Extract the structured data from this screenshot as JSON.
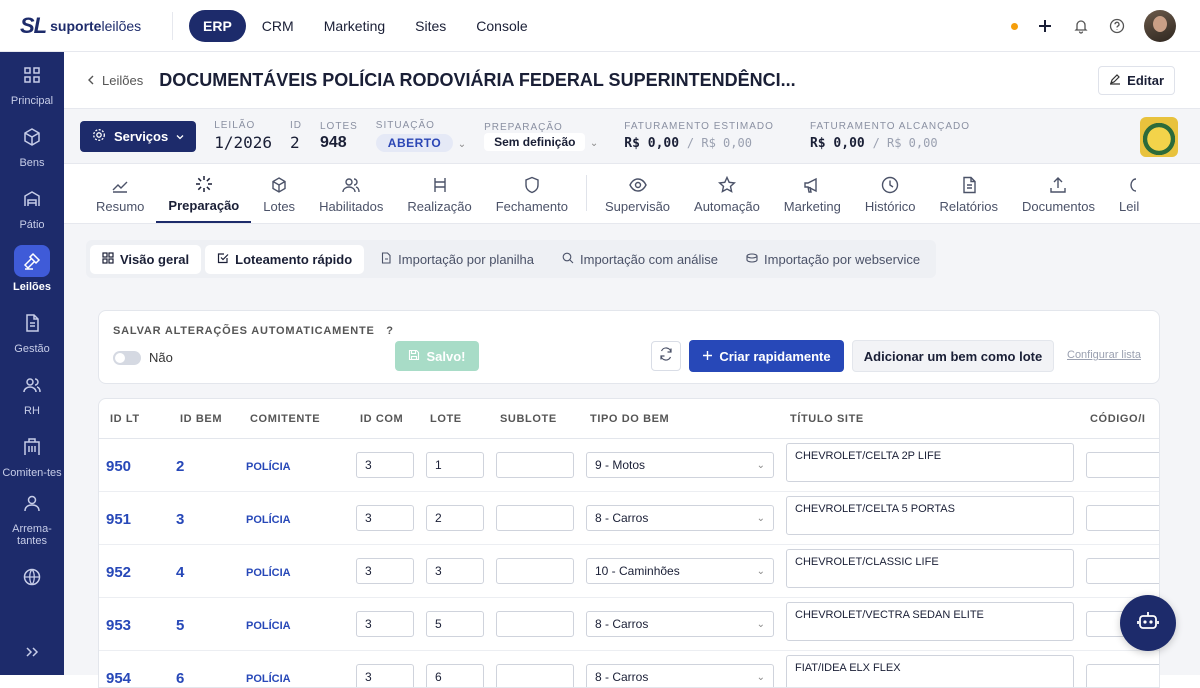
{
  "brand": {
    "mark": "SL",
    "name_bold": "suporte",
    "name_rest": "leilões"
  },
  "topnav": [
    {
      "label": "ERP",
      "active": true
    },
    {
      "label": "CRM"
    },
    {
      "label": "Marketing"
    },
    {
      "label": "Sites"
    },
    {
      "label": "Console"
    }
  ],
  "sidebar": [
    {
      "label": "Principal",
      "icon": "grid-icon"
    },
    {
      "label": "Bens",
      "icon": "box-icon"
    },
    {
      "label": "Pátio",
      "icon": "warehouse-icon"
    },
    {
      "label": "Leilões",
      "icon": "gavel-icon",
      "active": true
    },
    {
      "label": "Gestão",
      "icon": "document-icon"
    },
    {
      "label": "RH",
      "icon": "users-icon"
    },
    {
      "label": "Comiten-tes",
      "icon": "building-icon"
    },
    {
      "label": "Arrema-tantes",
      "icon": "person-icon"
    },
    {
      "label": "",
      "icon": "globe-icon"
    }
  ],
  "header": {
    "back_label": "Leilões",
    "title": "DOCUMENTÁVEIS POLÍCIA RODOVIÁRIA FEDERAL SUPERINTENDÊNCI...",
    "edit_label": "Editar"
  },
  "info": {
    "services_label": "Serviços",
    "leilao_label": "LEILÃO",
    "leilao_value": "1/2026",
    "id_label": "ID",
    "id_value": "2",
    "lotes_label": "LOTES",
    "lotes_value": "948",
    "situacao_label": "SITUAÇÃO",
    "situacao_value": "ABERTO",
    "preparacao_label": "PREPARAÇÃO",
    "preparacao_value": "Sem definição",
    "fat_est_label": "FATURAMENTO ESTIMADO",
    "fat_est_value": "R$ 0,00",
    "fat_est_secondary": "/ R$ 0,00",
    "fat_alc_label": "FATURAMENTO ALCANÇADO",
    "fat_alc_value": "R$ 0,00",
    "fat_alc_secondary": "/ R$ 0,00"
  },
  "tabs": [
    {
      "label": "Resumo",
      "icon": "chart-line-icon"
    },
    {
      "label": "Preparação",
      "icon": "loader-icon",
      "active": true
    },
    {
      "label": "Lotes",
      "icon": "box-icon"
    },
    {
      "label": "Habilitados",
      "icon": "users-icon"
    },
    {
      "label": "Realização",
      "icon": "hammer-icon"
    },
    {
      "label": "Fechamento",
      "icon": "shield-icon"
    },
    {
      "label": "Supervisão",
      "icon": "eye-icon"
    },
    {
      "label": "Automação",
      "icon": "star-icon"
    },
    {
      "label": "Marketing",
      "icon": "megaphone-icon"
    },
    {
      "label": "Histórico",
      "icon": "clock-icon"
    },
    {
      "label": "Relatórios",
      "icon": "file-icon"
    },
    {
      "label": "Documentos",
      "icon": "upload-icon"
    },
    {
      "label": "Leil",
      "icon": "more-icon"
    }
  ],
  "subtabs": [
    {
      "label": "Visão geral",
      "icon": "grid-icon",
      "selected": true
    },
    {
      "label": "Loteamento rápido",
      "icon": "checkbox-icon",
      "selected": true
    },
    {
      "label": "Importação por planilha",
      "icon": "file-icon"
    },
    {
      "label": "Importação com análise",
      "icon": "search-icon"
    },
    {
      "label": "Importação por webservice",
      "icon": "database-icon"
    }
  ],
  "save": {
    "title": "SALVAR ALTERAÇÕES AUTOMATICAMENTE",
    "help": "?",
    "toggle_label": "Não",
    "saved_label": "Salvo!",
    "create_label": "Criar rapidamente",
    "add_label": "Adicionar um bem como lote",
    "config_label": "Configurar lista"
  },
  "table": {
    "headers": [
      "ID LT",
      "ID BEM",
      "COMITENTE",
      "ID COM",
      "LOTE",
      "SUBLOTE",
      "TIPO DO BEM",
      "TÍTULO SITE",
      "CÓDIGO/I"
    ],
    "rows": [
      {
        "id_lt": "950",
        "id_bem": "2",
        "comitente": "POLÍCIA",
        "id_com": "3",
        "lote": "1",
        "sublote": "",
        "tipo": "9 - Motos",
        "titulo": "CHEVROLET/CELTA 2P LIFE",
        "codigo": ""
      },
      {
        "id_lt": "951",
        "id_bem": "3",
        "comitente": "POLÍCIA",
        "id_com": "3",
        "lote": "2",
        "sublote": "",
        "tipo": "8 - Carros",
        "titulo": "CHEVROLET/CELTA 5 PORTAS",
        "codigo": ""
      },
      {
        "id_lt": "952",
        "id_bem": "4",
        "comitente": "POLÍCIA",
        "id_com": "3",
        "lote": "3",
        "sublote": "",
        "tipo": "10 - Caminhões",
        "titulo": "CHEVROLET/CLASSIC LIFE",
        "codigo": ""
      },
      {
        "id_lt": "953",
        "id_bem": "5",
        "comitente": "POLÍCIA",
        "id_com": "3",
        "lote": "5",
        "sublote": "",
        "tipo": "8 - Carros",
        "titulo": "CHEVROLET/VECTRA SEDAN ELITE",
        "codigo": ""
      },
      {
        "id_lt": "954",
        "id_bem": "6",
        "comitente": "POLÍCIA",
        "id_com": "3",
        "lote": "6",
        "sublote": "",
        "tipo": "8 - Carros",
        "titulo": "FIAT/IDEA ELX FLEX",
        "codigo": ""
      }
    ]
  },
  "colors": {
    "primary": "#1d2b6b",
    "accent": "#2748b8",
    "success_muted": "#a8dcc7",
    "notify": "#f59e0b"
  }
}
